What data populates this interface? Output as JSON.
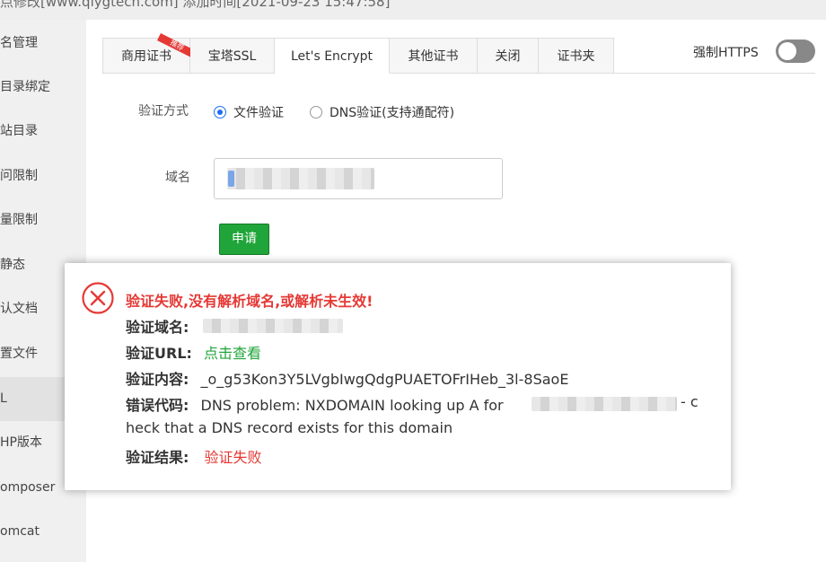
{
  "header": {
    "text": "点修改[www.qiygtech.com]   添加时间[2021-09-23 15:47:58]"
  },
  "sidebar": {
    "items": [
      {
        "label": "名管理"
      },
      {
        "label": "目录绑定"
      },
      {
        "label": "站目录"
      },
      {
        "label": "问限制"
      },
      {
        "label": "量限制"
      },
      {
        "label": "静态"
      },
      {
        "label": "认文档"
      },
      {
        "label": "置文件"
      },
      {
        "label": "L"
      },
      {
        "label": "HP版本"
      },
      {
        "label": "omposer"
      },
      {
        "label": "omcat"
      }
    ]
  },
  "tabs": [
    {
      "label": "商用证书",
      "badge": "推荐"
    },
    {
      "label": "宝塔SSL"
    },
    {
      "label": "Let's Encrypt"
    },
    {
      "label": "其他证书"
    },
    {
      "label": "关闭"
    },
    {
      "label": "证书夹"
    }
  ],
  "force_https": {
    "label": "强制HTTPS",
    "enabled": false
  },
  "form": {
    "verify_label": "验证方式",
    "option_file": "文件验证",
    "option_dns": "DNS验证(支持通配符)",
    "domain_label": "域名",
    "apply_button": "申请"
  },
  "dialog": {
    "title": "验证失败,没有解析域名,或解析未生效!",
    "domain_label": "验证域名:",
    "url_label": "验证URL:",
    "url_link": "点击查看",
    "content_label": "验证内容:",
    "content_value": "_o_g53Kon3Y5LVgbIwgQdgPUAETOFrIHeb_3l-8SaoE",
    "error_label": "错误代码:",
    "error_value_1": "DNS problem: NXDOMAIN looking up A for",
    "error_value_2": "- c",
    "error_value_3": "heck that a DNS record exists for this domain",
    "result_label": "验证结果:",
    "result_value": "验证失败"
  },
  "colors": {
    "accent_green": "#20a53a",
    "error_red": "#e53935",
    "radio_blue": "#1e6ff0"
  }
}
